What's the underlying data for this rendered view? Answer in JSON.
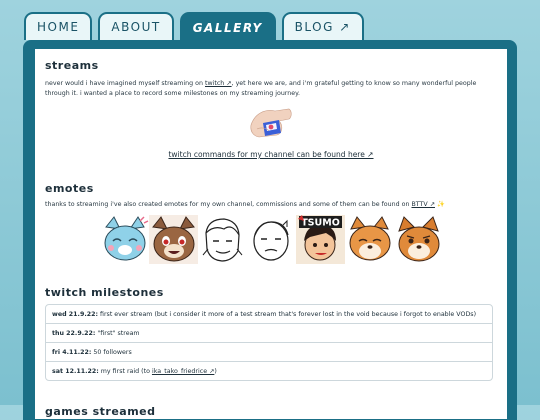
{
  "tabs": [
    {
      "label": "HOME",
      "active": false
    },
    {
      "label": "ABOUT",
      "active": false
    },
    {
      "label": "GALLERY",
      "active": true
    },
    {
      "label": "BLOG ↗",
      "active": false
    }
  ],
  "colors": {
    "accent": "#1a6f86",
    "background": "#8ccbd8",
    "panel": "#ffffff"
  },
  "streams": {
    "heading": "streams",
    "intro_before": "never would i have imagined myself streaming on ",
    "intro_link": "twitch ↗",
    "intro_after": ", yet here we are, and i'm grateful getting to know so many wonderful people through it. i wanted a place to record some milestones on my streaming journey.",
    "commands_link": "twitch commands for my channel can be found here ↗"
  },
  "emotes": {
    "heading": "emotes",
    "text_before": "thanks to streaming i've also created emotes for my own channel, commissions and some of them can be found on ",
    "text_link": "BTTV ↗",
    "sparkle": "✨",
    "tsumo_label": "TSUMO"
  },
  "milestones": {
    "heading": "twitch milestones",
    "items": [
      {
        "date": "wed 21.9.22:",
        "text": " first ever stream (but i consider it more of a test stream that's forever lost in the void because i forgot to enable VODs)"
      },
      {
        "date": "thu 22.9.22:",
        "text": " \"first\" stream"
      },
      {
        "date": "fri 4.11.22:",
        "text": " 50 followers"
      },
      {
        "date": "sat 12.11.22:",
        "text": " my first raid (to ",
        "link": "ika_tako_friedrice ↗",
        "after": ")"
      }
    ]
  },
  "games": {
    "heading": "games streamed"
  }
}
